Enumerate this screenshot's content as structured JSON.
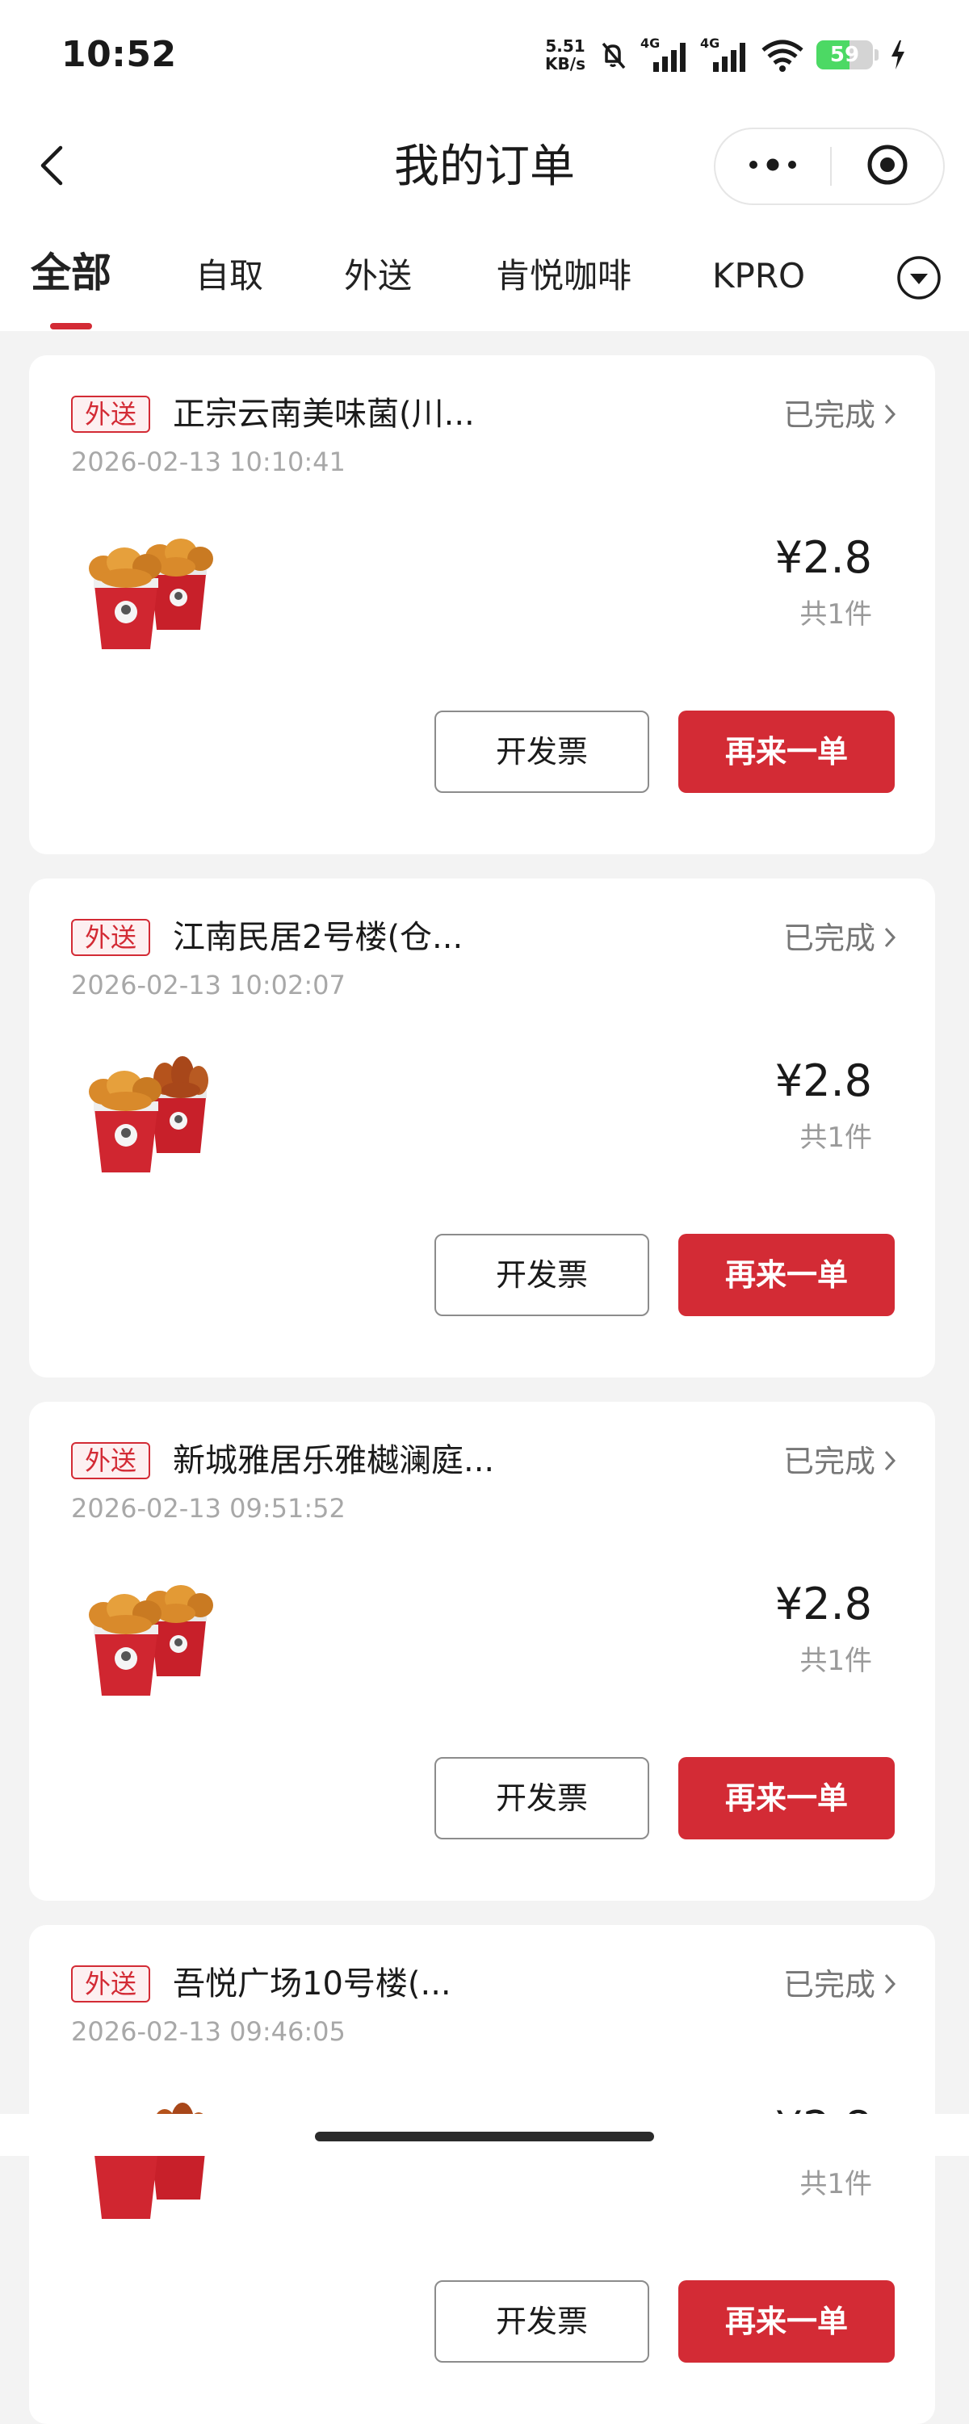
{
  "status_bar": {
    "time": "10:52",
    "net_speed_value": "5.51",
    "net_speed_unit": "KB/s",
    "network_1": "4G",
    "network_2": "4G",
    "battery_level": "59"
  },
  "header": {
    "title": "我的订单"
  },
  "tabs": [
    {
      "label": "全部",
      "active": true
    },
    {
      "label": "自取",
      "active": false
    },
    {
      "label": "外送",
      "active": false
    },
    {
      "label": "肯悦咖啡",
      "active": false
    },
    {
      "label": "KPRO",
      "active": false
    }
  ],
  "colors": {
    "accent": "#d32b35",
    "background": "#f3f3f3",
    "card": "#ffffff"
  },
  "orders": [
    {
      "tag": "外送",
      "store": "正宗云南美味菌(川...",
      "status": "已完成",
      "time": "2026-02-13 10:10:41",
      "price": "¥2.8",
      "count": "共1件",
      "invoice_label": "开发票",
      "reorder_label": "再来一单"
    },
    {
      "tag": "外送",
      "store": "江南民居2号楼(仓...",
      "status": "已完成",
      "time": "2026-02-13 10:02:07",
      "price": "¥2.8",
      "count": "共1件",
      "invoice_label": "开发票",
      "reorder_label": "再来一单"
    },
    {
      "tag": "外送",
      "store": "新城雅居乐雅樾澜庭...",
      "status": "已完成",
      "time": "2026-02-13 09:51:52",
      "price": "¥2.8",
      "count": "共1件",
      "invoice_label": "开发票",
      "reorder_label": "再来一单"
    },
    {
      "tag": "外送",
      "store": "吾悦广场10号楼(...",
      "status": "已完成",
      "time": "2026-02-13 09:46:05",
      "price": "¥2.8",
      "count": "共1件",
      "invoice_label": "开发票",
      "reorder_label": "再来一单"
    }
  ]
}
